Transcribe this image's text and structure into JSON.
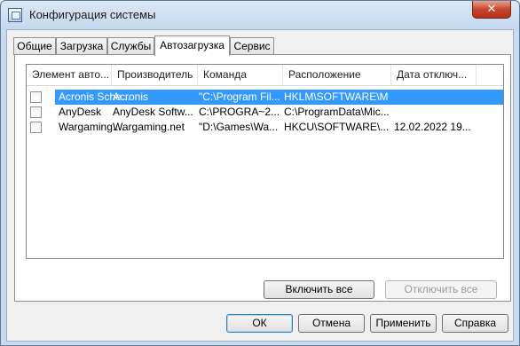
{
  "window": {
    "title": "Конфигурация системы",
    "close_glyph": "✕"
  },
  "tabs": [
    {
      "label": "Общие"
    },
    {
      "label": "Загрузка"
    },
    {
      "label": "Службы"
    },
    {
      "label": "Автозагрузка",
      "active": true
    },
    {
      "label": "Сервис"
    }
  ],
  "columns": [
    "Элемент авто...",
    "Производитель",
    "Команда",
    "Расположение",
    "Дата отключ..."
  ],
  "rows": [
    {
      "checked": false,
      "selected": true,
      "item": "Acronis Sche...",
      "manufacturer": "Acronis",
      "command": "\"C:\\Program Fil...",
      "location": "HKLM\\SOFTWARE\\M...",
      "date": ""
    },
    {
      "checked": false,
      "selected": false,
      "item": "AnyDesk",
      "manufacturer": "AnyDesk Softw...",
      "command": "C:\\PROGRA~2...",
      "location": "C:\\ProgramData\\Mic...",
      "date": ""
    },
    {
      "checked": false,
      "selected": false,
      "item": "Wargaming....",
      "manufacturer": "Wargaming.net",
      "command": "\"D:\\Games\\Wa...",
      "location": "HKCU\\SOFTWARE\\...",
      "date": "12.02.2022 19..."
    }
  ],
  "buttons": {
    "enable_all": "Включить все",
    "disable_all": "Отключить все",
    "ok": "ОК",
    "cancel": "Отмена",
    "apply": "Применить",
    "help": "Справка"
  },
  "colors": {
    "selection": "#3399ff",
    "close": "#c8462d",
    "frame": "#c9dbee"
  }
}
